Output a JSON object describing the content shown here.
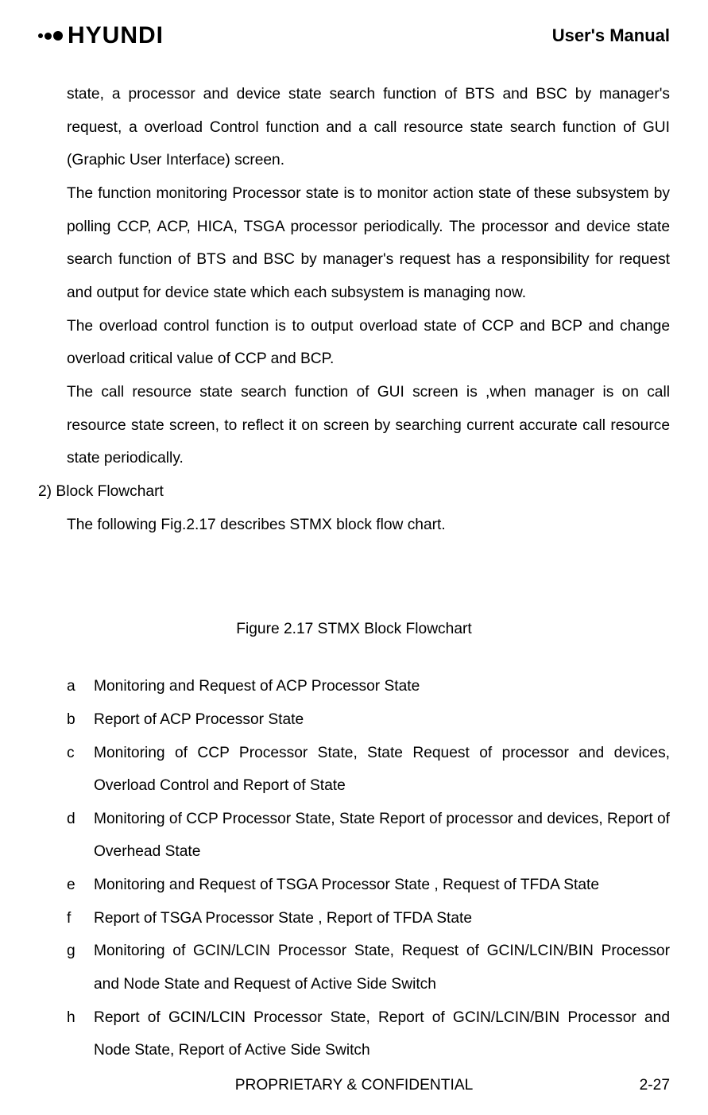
{
  "header": {
    "brand": "HYUNDI",
    "title": "User's Manual"
  },
  "content": {
    "para1": "state, a processor and  device state search function of BTS and BSC by manager's request, a overload  Control function and a call resource state search function of GUI (Graphic User Interface) screen.",
    "para2": "The function monitoring Processor state is to monitor action state of these subsystem by polling CCP, ACP, HICA, TSGA processor periodically. The processor and device state search function of BTS and BSC by manager's request has a responsibility for request and output for device state which each subsystem is managing now.",
    "para3": "The overload control function is to output overload state of CCP and BCP and change overload critical value of CCP and BCP.",
    "para4": "The call resource state search function of GUI screen is ,when manager is on call resource state screen, to reflect it on screen by searching current accurate call resource state periodically.",
    "section_heading": "2) Block Flowchart",
    "para5": "The following Fig.2.17 describes STMX block flow chart.",
    "figure_caption": "Figure 2.17 STMX Block Flowchart",
    "list": [
      {
        "marker": "a",
        "text": "Monitoring and Request of ACP Processor State"
      },
      {
        "marker": "b",
        "text": "Report of ACP Processor State"
      },
      {
        "marker": "c",
        "text": "Monitoring of CCP Processor State, State Request of processor and devices, Overload Control and Report of State"
      },
      {
        "marker": "d",
        "text": "Monitoring of CCP Processor State, State Report of processor and devices, Report of Overhead State"
      },
      {
        "marker": "e",
        "text": "Monitoring and Request of TSGA Processor State , Request of TFDA State"
      },
      {
        "marker": "f",
        "text": "Report of TSGA Processor State , Report of TFDA State"
      },
      {
        "marker": "g",
        "text": "Monitoring of GCIN/LCIN Processor State, Request of GCIN/LCIN/BIN Processor and Node State and Request of Active Side Switch"
      },
      {
        "marker": "h",
        "text": "Report of GCIN/LCIN Processor State, Report of GCIN/LCIN/BIN Processor and Node State, Report of Active Side Switch"
      }
    ]
  },
  "footer": {
    "center_text": "PROPRIETARY & CONFIDENTIAL",
    "page_number": "2-27"
  }
}
